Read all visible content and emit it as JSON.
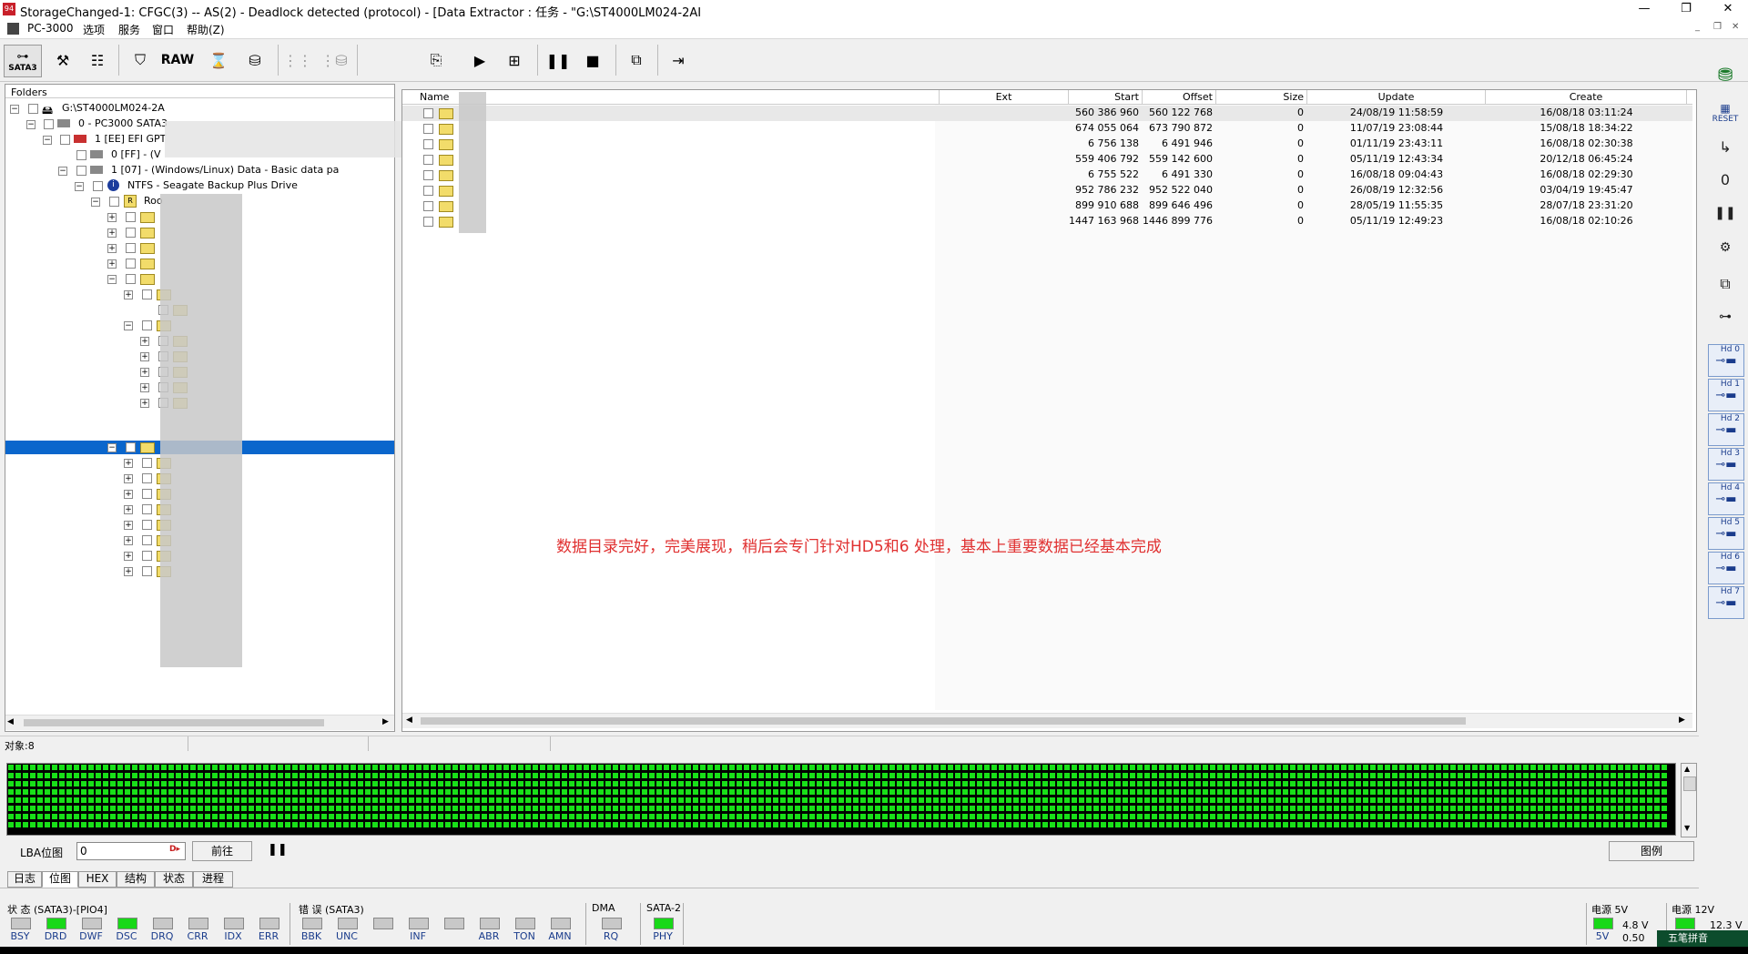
{
  "window": {
    "title": "StorageChanged-1: CFGC(3) -- AS(2) - Deadlock detected (protocol) - [Data Extractor : 任务 - \"G:\\ST4000LM024-2AI",
    "app_icon": "pc3000-icon"
  },
  "menu": [
    "PC-3000",
    "选项",
    "服务",
    "窗口",
    "帮助(Z)"
  ],
  "toolbar": {
    "sata_label": "SATA3",
    "raw_label": "RAW"
  },
  "folders": {
    "header": "Folders",
    "nodes": [
      {
        "label": "G:\\ST4000LM024-2A"
      },
      {
        "label": "0 - PC3000 SATA3"
      },
      {
        "label": "1 [EE] EFI GPT"
      },
      {
        "label": "0 [FF] - (V"
      },
      {
        "label": "1 [07] - (Windows/Linux) Data - Basic data pa"
      },
      {
        "label": "NTFS - Seagate Backup Plus Drive"
      },
      {
        "label": "Roo"
      }
    ]
  },
  "list": {
    "columns": [
      "Name",
      "Ext",
      "Start",
      "Offset",
      "Size",
      "Update",
      "Create"
    ],
    "rows": [
      {
        "start": "560 386 960",
        "offset": "560 122 768",
        "size": "0",
        "update": "24/08/19 11:58:59",
        "create": "16/08/18 03:11:24"
      },
      {
        "start": "674 055 064",
        "offset": "673 790 872",
        "size": "0",
        "update": "11/07/19 23:08:44",
        "create": "15/08/18 18:34:22"
      },
      {
        "start": "6 756 138",
        "offset": "6 491 946",
        "size": "0",
        "update": "01/11/19 23:43:11",
        "create": "16/08/18 02:30:38"
      },
      {
        "start": "559 406 792",
        "offset": "559 142 600",
        "size": "0",
        "update": "05/11/19 12:43:34",
        "create": "20/12/18 06:45:24"
      },
      {
        "start": "6 755 522",
        "offset": "6 491 330",
        "size": "0",
        "update": "16/08/18 09:04:43",
        "create": "16/08/18 02:29:30"
      },
      {
        "start": "952 786 232",
        "offset": "952 522 040",
        "size": "0",
        "update": "26/08/19 12:32:56",
        "create": "03/04/19 19:45:47"
      },
      {
        "start": "899 910 688",
        "offset": "899 646 496",
        "size": "0",
        "update": "28/05/19 11:55:35",
        "create": "28/07/18 23:31:20"
      },
      {
        "start": "1447 163 968",
        "offset": "1446 899 776",
        "size": "0",
        "update": "05/11/19 12:49:23",
        "create": "16/08/18 02:10:26"
      }
    ]
  },
  "annotation": "数据目录完好，完美展现，稍后会专门针对HD5和6 处理，基本上重要数据已经基本完成",
  "status": {
    "objects": "对象:8"
  },
  "lba": {
    "label": "LBA位图",
    "value": "0",
    "go_label": "前往",
    "legend_label": "图例"
  },
  "tabs": [
    "日志",
    "位图",
    "HEX",
    "结构",
    "状态",
    "进程"
  ],
  "indicators": {
    "state_title": "状 态 (SATA3)-[PIO4]",
    "state": [
      {
        "name": "BSY",
        "on": false
      },
      {
        "name": "DRD",
        "on": true
      },
      {
        "name": "DWF",
        "on": false
      },
      {
        "name": "DSC",
        "on": true
      },
      {
        "name": "DRQ",
        "on": false
      },
      {
        "name": "CRR",
        "on": false
      },
      {
        "name": "IDX",
        "on": false
      },
      {
        "name": "ERR",
        "on": false
      }
    ],
    "error_title": "错 误 (SATA3)",
    "error": [
      {
        "name": "BBK",
        "on": false
      },
      {
        "name": "UNC",
        "on": false
      },
      {
        "name": "",
        "on": false
      },
      {
        "name": "INF",
        "on": false
      },
      {
        "name": "",
        "on": false
      },
      {
        "name": "ABR",
        "on": false
      },
      {
        "name": "TON",
        "on": false
      },
      {
        "name": "AMN",
        "on": false
      }
    ],
    "dma_title": "DMA",
    "dma": [
      {
        "name": "RQ",
        "on": false
      }
    ],
    "sata_title": "SATA-2",
    "sata": [
      {
        "name": "PHY",
        "on": true
      }
    ],
    "power5_title": "电源 5V",
    "power5_label": "5V",
    "power5_values": [
      "4.8 V",
      "0.50"
    ],
    "power12_title": "电源 12V",
    "power12_value": "12.3 V"
  },
  "right_toolbar": {
    "reset_label": "RESET",
    "hd_labels": [
      "Hd 0",
      "Hd 1",
      "Hd 2",
      "Hd 3",
      "Hd 4",
      "Hd 5",
      "Hd 6",
      "Hd 7"
    ]
  },
  "ime": {
    "label": "五笔拼音"
  }
}
